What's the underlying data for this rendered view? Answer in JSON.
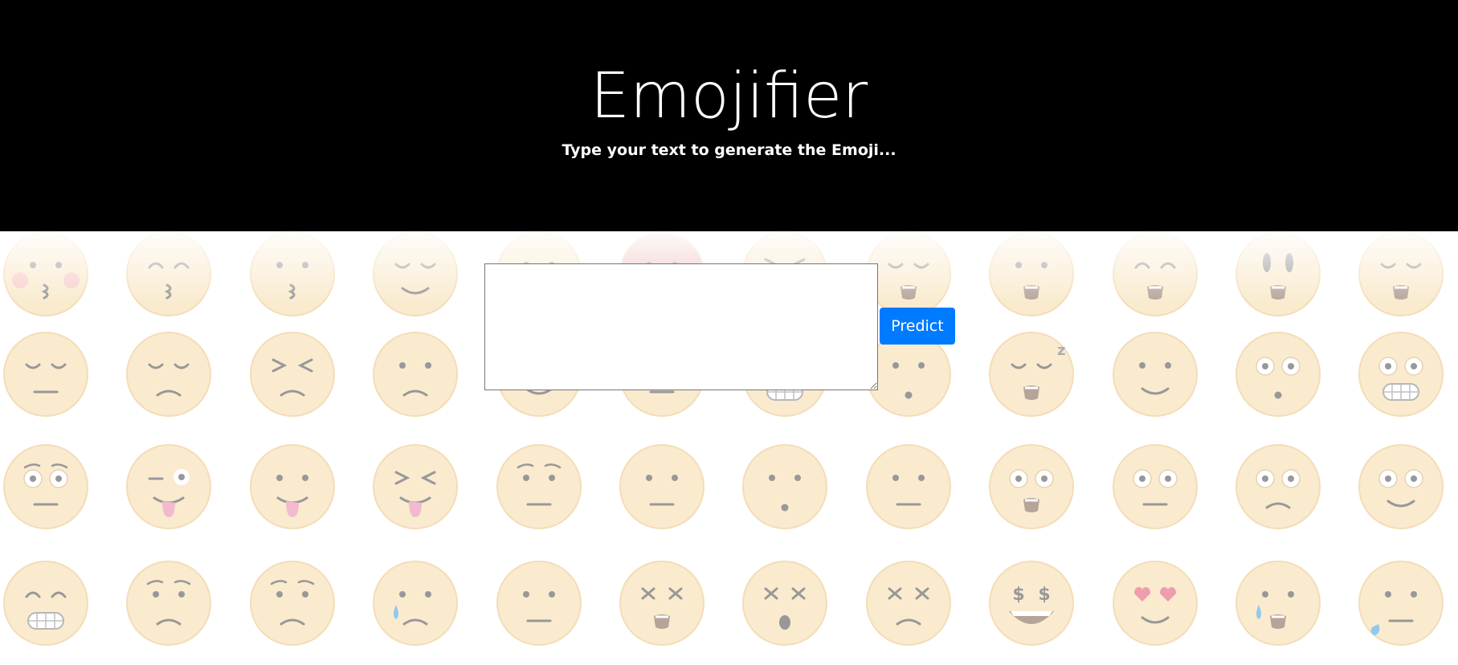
{
  "header": {
    "title": "Emojifier",
    "subtitle": "Type your text to generate the Emoji..."
  },
  "form": {
    "text_value": "",
    "placeholder": "",
    "predict_label": "Predict"
  },
  "background": {
    "face_color": "#f7dfb2",
    "face_outline": "#ecc98e",
    "feature_color": "#5a5a5a",
    "tongue_color": "#e992b0",
    "tear_color": "#4fa8e8",
    "heart_color": "#e4627f",
    "angry_color": "#e8a0a0",
    "expressions": [
      [
        "kiss-blush",
        "kiss-closed",
        "kiss",
        "calm-smile",
        "annoyed",
        "angry",
        "squint-grin",
        "screaming",
        "surprised",
        "happy-open",
        "shocked",
        "relieved-open"
      ],
      [
        "pensive",
        "sad-closed",
        "persevering",
        "sad-sweat",
        "smile-closed",
        "neutral-down",
        "squint-teeth",
        "hushed",
        "sleeping",
        "smirk",
        "astonished",
        "grimace"
      ],
      [
        "flushed",
        "wink-tongue",
        "tongue",
        "squint-tongue",
        "frown-brows",
        "neutral",
        "hushed",
        "expressionless",
        "wide-open",
        "wide-neutral",
        "wide-frown",
        "wide-smile"
      ],
      [
        "grin-closed",
        "worried",
        "sad-brows",
        "crying",
        "expressionless-lines",
        "dizzy",
        "dizzy-open",
        "tired",
        "money",
        "heart-eyes",
        "cry-open",
        "sweat-neutral"
      ]
    ],
    "accent_color": "#007bff"
  }
}
